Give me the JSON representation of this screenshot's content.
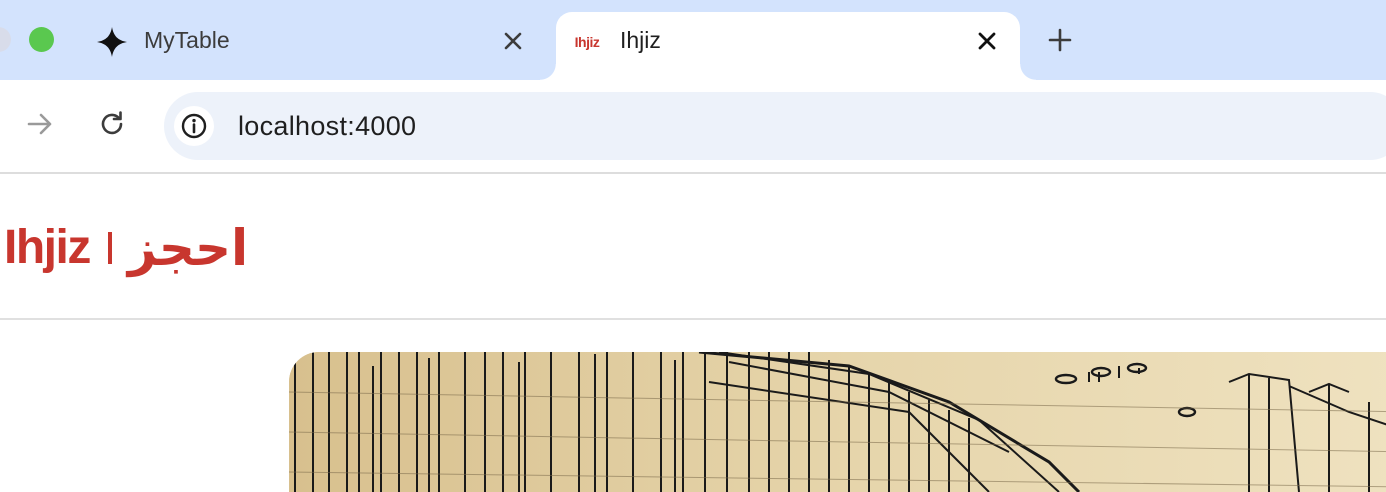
{
  "browser": {
    "tabs": [
      {
        "title": "MyTable",
        "icon": "sparkle-icon",
        "active": false
      },
      {
        "title": "Ihjiz",
        "favicon_text": "Ihjiz",
        "active": true
      }
    ],
    "address_bar": {
      "url": "localhost:4000"
    }
  },
  "site": {
    "logo": {
      "latin": "Ihjiz",
      "arabic": "احجز"
    },
    "hero": {
      "image": "architectural-sketch-building"
    }
  },
  "colors": {
    "tabbar_bg": "#d3e3fd",
    "brand_red": "#c8362e",
    "omnibox_bg": "#edf2fa",
    "hero_paper": "#e2cfa3"
  }
}
